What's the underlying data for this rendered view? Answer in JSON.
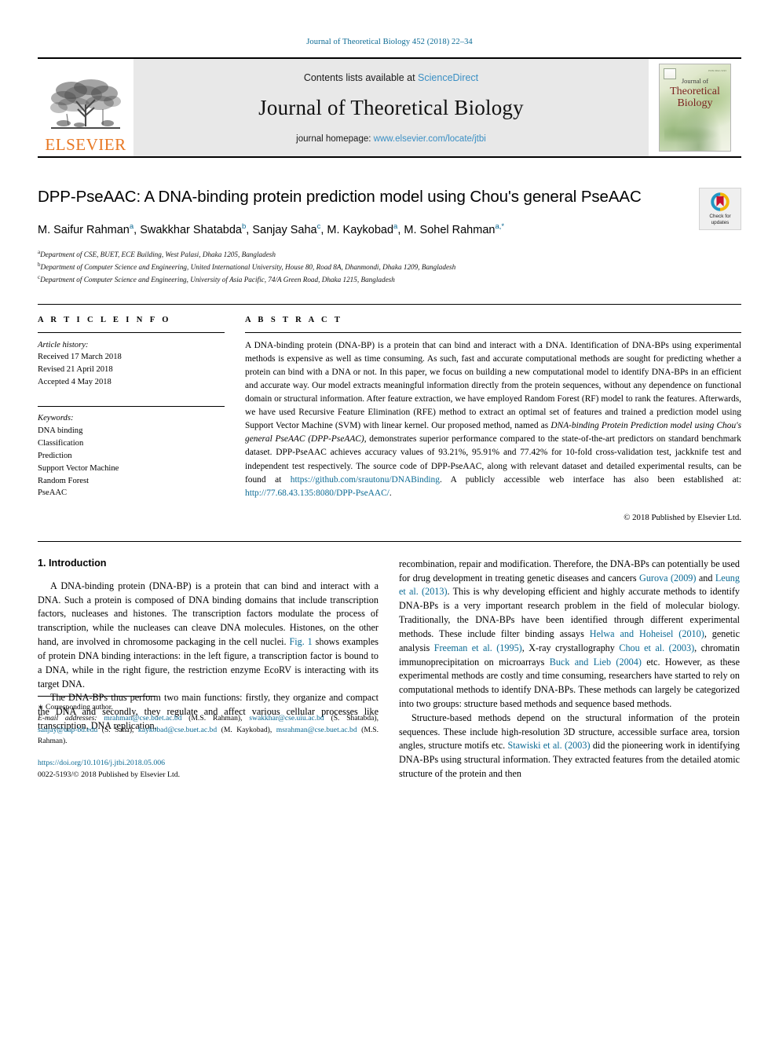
{
  "running_head": "Journal of Theoretical Biology 452 (2018) 22–34",
  "masthead": {
    "publisher": "ELSEVIER",
    "contents_prefix": "Contents lists available at",
    "contents_link": "ScienceDirect",
    "journal_title": "Journal of Theoretical Biology",
    "homepage_prefix": "journal homepage:",
    "homepage_link": "www.elsevier.com/locate/jtbi",
    "cover": {
      "line1": "Journal of",
      "line2": "Theoretical",
      "line3": "Biology",
      "corner_code": "ISSN 0022-5193"
    }
  },
  "crossmark": {
    "line1": "Check for",
    "line2": "updates"
  },
  "article": {
    "title": "DPP-PseAAC: A DNA-binding protein prediction model using Chou's general PseAAC",
    "authors_html": "M. Saifur Rahman<sup>a</sup>, Swakkhar Shatabda<sup>b</sup>, Sanjay Saha<sup>c</sup>, M. Kaykobad<sup>a</sup>, M. Sohel Rahman<sup>a,</sup><sup class=\"star\">*</sup>",
    "affiliations": [
      {
        "marker": "a",
        "text": "Department of CSE, BUET, ECE Building, West Palasi, Dhaka 1205, Bangladesh"
      },
      {
        "marker": "b",
        "text": "Department of Computer Science and Engineering, United International University, House 80, Road 8A, Dhanmondi, Dhaka 1209, Bangladesh"
      },
      {
        "marker": "c",
        "text": "Department of Computer Science and Engineering, University of Asia Pacific, 74/A Green Road, Dhaka 1215, Bangladesh"
      }
    ]
  },
  "article_info": {
    "heading": "A R T I C L E   I N F O",
    "history_label": "Article history:",
    "history": [
      "Received 17 March 2018",
      "Revised 21 April 2018",
      "Accepted 4 May 2018"
    ],
    "keywords_label": "Keywords:",
    "keywords": [
      "DNA binding",
      "Classification",
      "Prediction",
      "Support Vector Machine",
      "Random Forest",
      "PseAAC"
    ]
  },
  "abstract": {
    "heading": "A B S T R A C T",
    "text_html": "A DNA-binding protein (DNA-BP) is a protein that can bind and interact with a DNA. Identification of DNA-BPs using experimental methods is expensive as well as time consuming. As such, fast and accurate computational methods are sought for predicting whether a protein can bind with a DNA or not. In this paper, we focus on building a new computational model to identify DNA-BPs in an efficient and accurate way. Our model extracts meaningful information directly from the protein sequences, without any dependence on functional domain or structural information. After feature extraction, we have employed Random Forest (RF) model to rank the features. Afterwards, we have used Recursive Feature Elimination (RFE) method to extract an optimal set of features and trained a prediction model using Support Vector Machine (SVM) with linear kernel. Our proposed method, named as <i>DNA-binding Protein Prediction model using Chou's general PseAAC (DPP-PseAAC)</i>, demonstrates superior performance compared to the state-of-the-art predictors on standard benchmark dataset. DPP-PseAAC achieves accuracy values of 93.21%, 95.91% and 77.42% for 10-fold cross-validation test, jackknife test and independent test respectively. The source code of DPP-PseAAC, along with relevant dataset and detailed experimental results, can be found at <a href=\"#\" data-name=\"abstract-github-link\" data-interactable=\"true\">https://github.com/srautonu/DNABinding</a>. A publicly accessible web interface has also been established at: <a href=\"#\" data-name=\"abstract-webinterface-link\" data-interactable=\"true\">http://77.68.43.135:8080/DPP-PseAAC/</a>.",
    "copyright": "© 2018 Published by Elsevier Ltd."
  },
  "body": {
    "section_heading": "1. Introduction",
    "left_paragraphs_html": [
      "A DNA-binding protein (DNA-BP) is a protein that can bind and interact with a DNA. Such a protein is composed of DNA binding domains that include transcription factors, nucleases and histones. The transcription factors modulate the process of transcription, while the nucleases can cleave DNA molecules. Histones, on the other hand, are involved in chromosome packaging in the cell nuclei. <a href=\"#\" data-name=\"figure-1-link\" data-interactable=\"true\">Fig. 1</a> shows examples of protein DNA binding interactions: in the left figure, a transcription factor is bound to a DNA, while in the right figure, the restriction enzyme EcoRV is interacting with its target DNA.",
      "The DNA-BPs thus perform two main functions: firstly, they organize and compact the DNA and secondly, they regulate and affect various cellular processes like transcription, DNA replication,"
    ],
    "right_paragraphs_html": [
      "recombination, repair and modification. Therefore, the DNA-BPs can potentially be used for drug development in treating genetic diseases and cancers <a href=\"#\" data-name=\"citation-gurova-2009\" data-interactable=\"true\">Gurova (2009)</a> and <a href=\"#\" data-name=\"citation-leung-2013\" data-interactable=\"true\">Leung et al. (2013)</a>. This is why developing efficient and highly accurate methods to identify DNA-BPs is a very important research problem in the field of molecular biology. Traditionally, the DNA-BPs have been identified through different experimental methods. These include filter binding assays <a href=\"#\" data-name=\"citation-helwa-2010\" data-interactable=\"true\">Helwa and Hoheisel (2010)</a>, genetic analysis <a href=\"#\" data-name=\"citation-freeman-1995\" data-interactable=\"true\">Freeman et al. (1995)</a>, X-ray crystallography <a href=\"#\" data-name=\"citation-chou-2003\" data-interactable=\"true\">Chou et al. (2003)</a>, chromatin immunoprecipitation on microarrays <a href=\"#\" data-name=\"citation-buck-2004\" data-interactable=\"true\">Buck and Lieb (2004)</a> etc. However, as these experimental methods are costly and time consuming, researchers have started to rely on computational methods to identify DNA-BPs. These methods can largely be categorized into two groups: structure based methods and sequence based methods.",
      "Structure-based methods depend on the structural information of the protein sequences. These include high-resolution 3D structure, accessible surface area, torsion angles, structure motifs etc. <a href=\"#\" data-name=\"citation-stawiski-2003\" data-interactable=\"true\">Stawiski et al. (2003)</a> did the pioneering work in identifying DNA-BPs using structural information. They extracted features from the detailed atomic structure of the protein and then"
    ]
  },
  "footnote": {
    "corresponding": "Corresponding author.",
    "emails_html": "<i>E-mail addresses:</i> <a href=\"#\" data-name=\"email-msrahman-1\" data-interactable=\"true\">mrahman@cse.buet.ac.bd</a> (M.S. Rahman), <a href=\"#\" data-name=\"email-swakkhar\" data-interactable=\"true\">swakkhar@cse.uiu.ac.bd</a> (S. Shatabda), <a href=\"#\" data-name=\"email-sanjay\" data-interactable=\"true\">sanjay@uap-bd.edu</a> (S. Saha), <a href=\"#\" data-name=\"email-kaykobad\" data-interactable=\"true\">kaykobad@cse.buet.ac.bd</a> (M. Kaykobad), <a href=\"#\" data-name=\"email-msrahman-2\" data-interactable=\"true\">msrahman@cse.buet.ac.bd</a> (M.S. Rahman).",
    "doi": "https://doi.org/10.1016/j.jtbi.2018.05.006",
    "issn_line": "0022-5193/© 2018 Published by Elsevier Ltd."
  },
  "colors": {
    "link_blue": "#0b6a94",
    "sciencedirect_blue": "#3a8fc4",
    "elsevier_orange": "#E87722",
    "banner_gray": "#e8e8e8"
  }
}
